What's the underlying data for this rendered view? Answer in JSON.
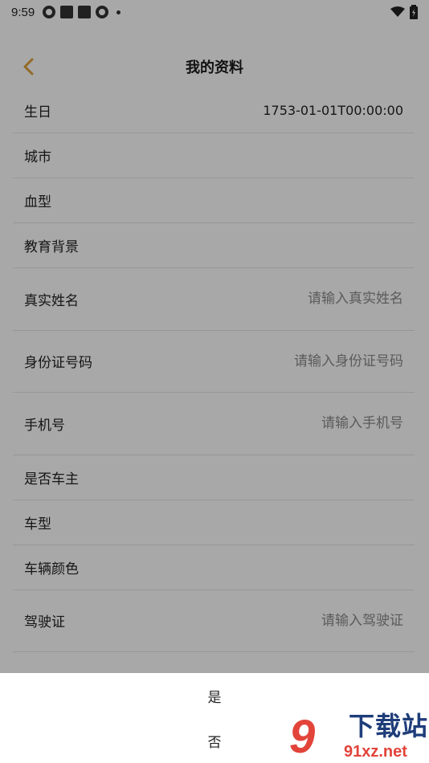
{
  "status_bar": {
    "time": "9:59",
    "icons": [
      "aperture-icon",
      "square-icon",
      "square-icon",
      "aperture-icon",
      "dot-icon"
    ],
    "right_icons": [
      "wifi-icon",
      "battery-icon"
    ]
  },
  "header": {
    "title": "我的资料",
    "back_icon": "chevron-left-icon",
    "accent_color": "#E0A23A"
  },
  "rows": [
    {
      "label": "生日",
      "value": "1753-01-01T00:00:00"
    },
    {
      "label": "城市",
      "value": ""
    },
    {
      "label": "血型",
      "value": ""
    },
    {
      "label": "教育背景",
      "value": ""
    },
    {
      "label": "真实姓名",
      "placeholder": "请输入真实姓名"
    },
    {
      "label": "身份证号码",
      "placeholder": "请输入身份证号码"
    },
    {
      "label": "手机号",
      "placeholder": "请输入手机号"
    },
    {
      "label": "是否车主",
      "value": ""
    },
    {
      "label": "车型",
      "value": ""
    },
    {
      "label": "车辆颜色",
      "value": ""
    },
    {
      "label": "驾驶证",
      "placeholder": "请输入驾驶证"
    }
  ],
  "sheet": {
    "options": [
      "是",
      "否"
    ]
  },
  "watermark": {
    "logo_text": "9",
    "title": "下载站",
    "subtitle": "91xz.net"
  }
}
